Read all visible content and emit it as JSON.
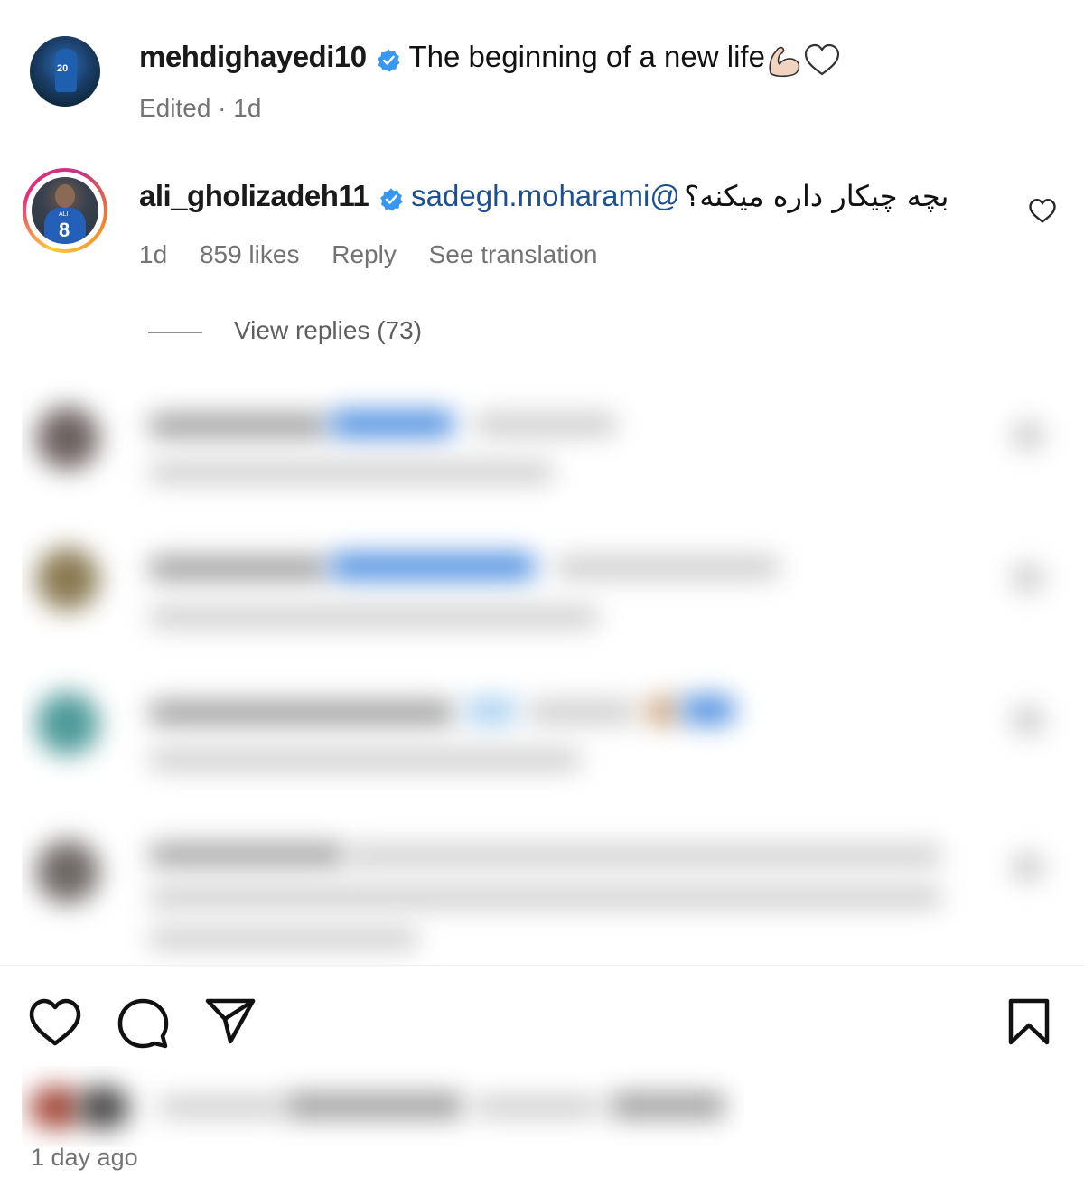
{
  "post": {
    "username": "mehdighayedi10",
    "caption": "The beginning of a new life",
    "meta": "Edited · 1d",
    "avatar_number": "20",
    "icons": [
      "verified-badge-icon",
      "flexed-biceps-emoji",
      "white-heart-emoji"
    ]
  },
  "comment": {
    "username": "ali_gholizadeh11",
    "mention": "sadegh.moharami@",
    "text": "بچه چیکار داره میکنه؟",
    "time": "1d",
    "likes": "859 likes",
    "reply_label": "Reply",
    "translate_label": "See translation",
    "view_replies": "View replies (73)",
    "avatar_number": "8",
    "avatar_name": "ALI"
  },
  "footer": {
    "timestamp": "1 day ago"
  },
  "colors": {
    "mention": "#1d4f91",
    "verified": "#3897f0",
    "meta": "#737373"
  }
}
